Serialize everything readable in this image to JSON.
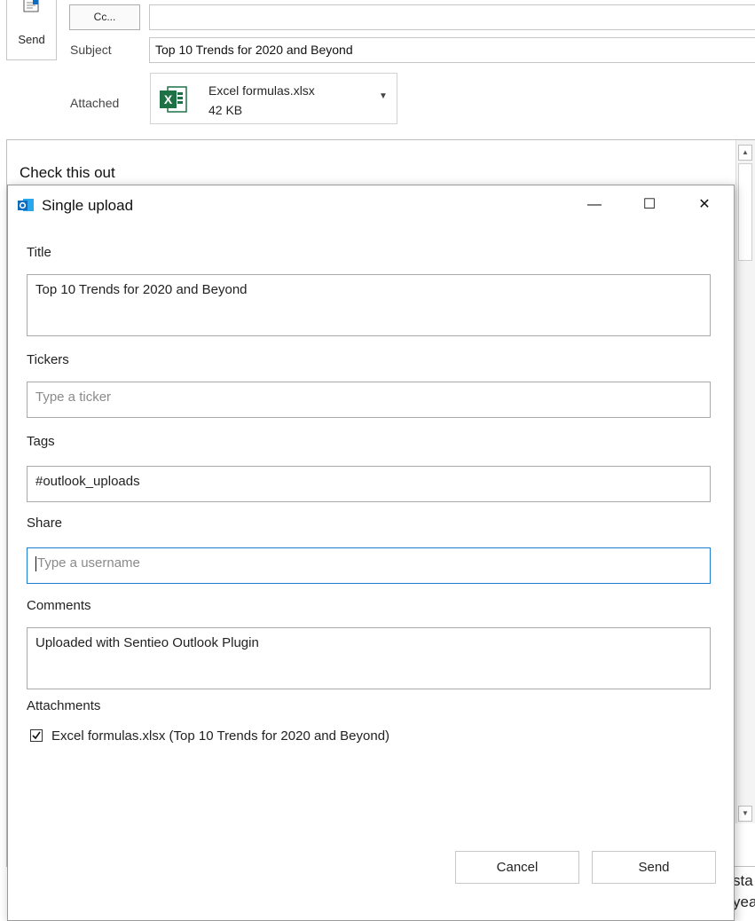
{
  "compose": {
    "send_label": "Send",
    "cc_label": "Cc...",
    "cc_value": "",
    "subject_label": "Subject",
    "subject_value": "Top 10 Trends for 2020 and Beyond",
    "attached_label": "Attached",
    "attachment": {
      "file_name": "Excel formulas.xlsx",
      "file_size": "42 KB",
      "icon": "excel-file-icon"
    },
    "body_text": "Check this out",
    "background_fragments": [
      "sta",
      "yea"
    ]
  },
  "dialog": {
    "title": "Single upload",
    "app_icon": "outlook-icon",
    "window_controls": {
      "minimize": "—",
      "maximize": "☐",
      "close": "✕"
    },
    "title_label": "Title",
    "title_value": "Top 10 Trends for 2020 and Beyond",
    "tickers_label": "Tickers",
    "tickers_placeholder": "Type a ticker",
    "tags_label": "Tags",
    "tags_value": "#outlook_uploads",
    "share_label": "Share",
    "share_placeholder": "Type a username",
    "comments_label": "Comments",
    "comments_value": "Uploaded with Sentieo Outlook Plugin",
    "attachments_label": "Attachments",
    "attachments": [
      {
        "label": "Excel formulas.xlsx (Top 10 Trends for 2020 and Beyond)",
        "checked": true
      }
    ],
    "cancel_label": "Cancel",
    "send_label": "Send"
  },
  "colors": {
    "focus_border": "#1c7dd6",
    "outlook_blue": "#0f6cbd",
    "excel_green": "#1e7145"
  }
}
